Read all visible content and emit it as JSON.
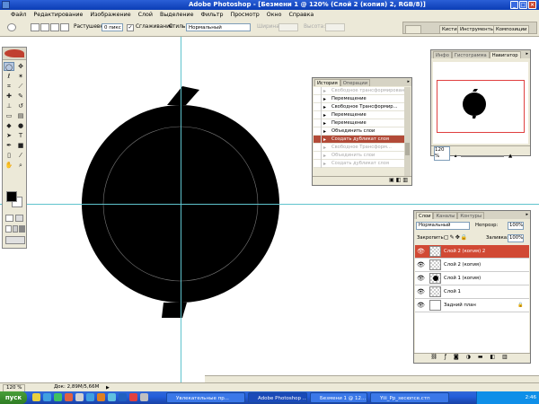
{
  "app": {
    "title": "Adobe Photoshop - [Безмени 1 @ 120% (Слой 2 (копия) 2, RGB/8)]",
    "min": "_",
    "max": "□",
    "close": "×"
  },
  "menu": [
    "Файл",
    "Редактирование",
    "Изображение",
    "Слой",
    "Выделение",
    "Фильтр",
    "Просмотр",
    "Окно",
    "Справка"
  ],
  "options": {
    "feather_label": "Растушевка:",
    "feather_value": "0 пикс",
    "antialias_label": "Сглаживание",
    "style_label": "Стиль:",
    "style_value": "Нормальный",
    "width_label": "Ширина:",
    "height_label": "Высота:"
  },
  "well_tabs": [
    "Кисти",
    "Инструменты",
    "Композиции"
  ],
  "history": {
    "tabs": [
      "История",
      "Операции"
    ],
    "items": [
      {
        "label": "Свободное трансформирование",
        "state": "grey"
      },
      {
        "label": "Перемещение",
        "state": "normal"
      },
      {
        "label": "Свободное Трансформир...",
        "state": "normal"
      },
      {
        "label": "Перемещение",
        "state": "normal"
      },
      {
        "label": "Перемещение",
        "state": "normal"
      },
      {
        "label": "Объединить слои",
        "state": "normal"
      },
      {
        "label": "Создать дубликат слоя",
        "state": "active"
      },
      {
        "label": "Свободное Трансформ...",
        "state": "grey"
      },
      {
        "label": "Объединить слои",
        "state": "grey"
      },
      {
        "label": "Создать дубликат слоя",
        "state": "grey"
      }
    ]
  },
  "navigator": {
    "tabs": [
      "Инфо",
      "Гистограмма",
      "Навигатор"
    ],
    "zoom": "120 %"
  },
  "layers": {
    "tabs": [
      "Слои",
      "Каналы",
      "Контуры"
    ],
    "blend": "Нормальный",
    "opacity_label": "Непрозр:",
    "opacity": "100%",
    "lock_label": "Закрепить:",
    "fill_label": "Заливка:",
    "fill": "100%",
    "items": [
      {
        "label": "Слой 2 (копия) 2",
        "active": true,
        "lock": ""
      },
      {
        "label": "Слой 2 (копия)",
        "active": false,
        "lock": ""
      },
      {
        "label": "Слой 1 (копия)",
        "active": false,
        "lock": ""
      },
      {
        "label": "Слой 1",
        "active": false,
        "lock": ""
      },
      {
        "label": "Задний план",
        "active": false,
        "lock": "🔒"
      }
    ]
  },
  "status": {
    "zoom": "120 %",
    "doc": "Док: 2,89M/5,66M"
  },
  "taskbar": {
    "start": "пуск",
    "buttons": [
      "Увлекательные пр...",
      "Adobe Photoshop ...",
      "Безмени 1 @ 12...",
      "Yiii_Pp_зесюпсе.стп"
    ],
    "clock": "2:46"
  },
  "icons": {
    "window": "photoshop-icon",
    "eye": "eye-icon"
  },
  "colors": {
    "title": "#0b3db5",
    "active_layer": "#d14934",
    "guides": "#5fc3cd"
  }
}
